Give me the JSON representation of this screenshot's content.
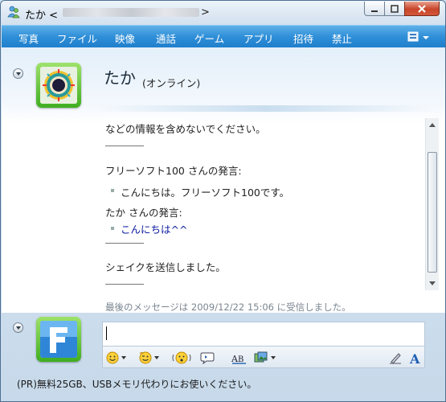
{
  "window": {
    "title_prefix": "たか <",
    "title_suffix": ">"
  },
  "menu": {
    "items": [
      "写真",
      "ファイル",
      "映像",
      "通話",
      "ゲーム",
      "アプリ",
      "招待",
      "禁止"
    ]
  },
  "contact": {
    "name": "たか",
    "status": "(オンライン)"
  },
  "conversation": {
    "line1": "などの情報を含めないでください。",
    "sender1": "フリーソフト100 さんの発言:",
    "msg1": "こんにちは。フリーソフト100です。",
    "sender2": "たか さんの発言:",
    "msg2": "こんにちは^^",
    "nudge": "シェイクを送信しました。",
    "last_message": "最後のメッセージは 2009/12/22 15:06 に受信しました。"
  },
  "ad": {
    "text": "(PR)無料25GB、USBメモリ代わりにお使いください。"
  },
  "colors": {
    "menu_bar": "#2f8fd8",
    "avatar_frame": "#3fae21",
    "msg2_color": "#0a1aa0"
  }
}
